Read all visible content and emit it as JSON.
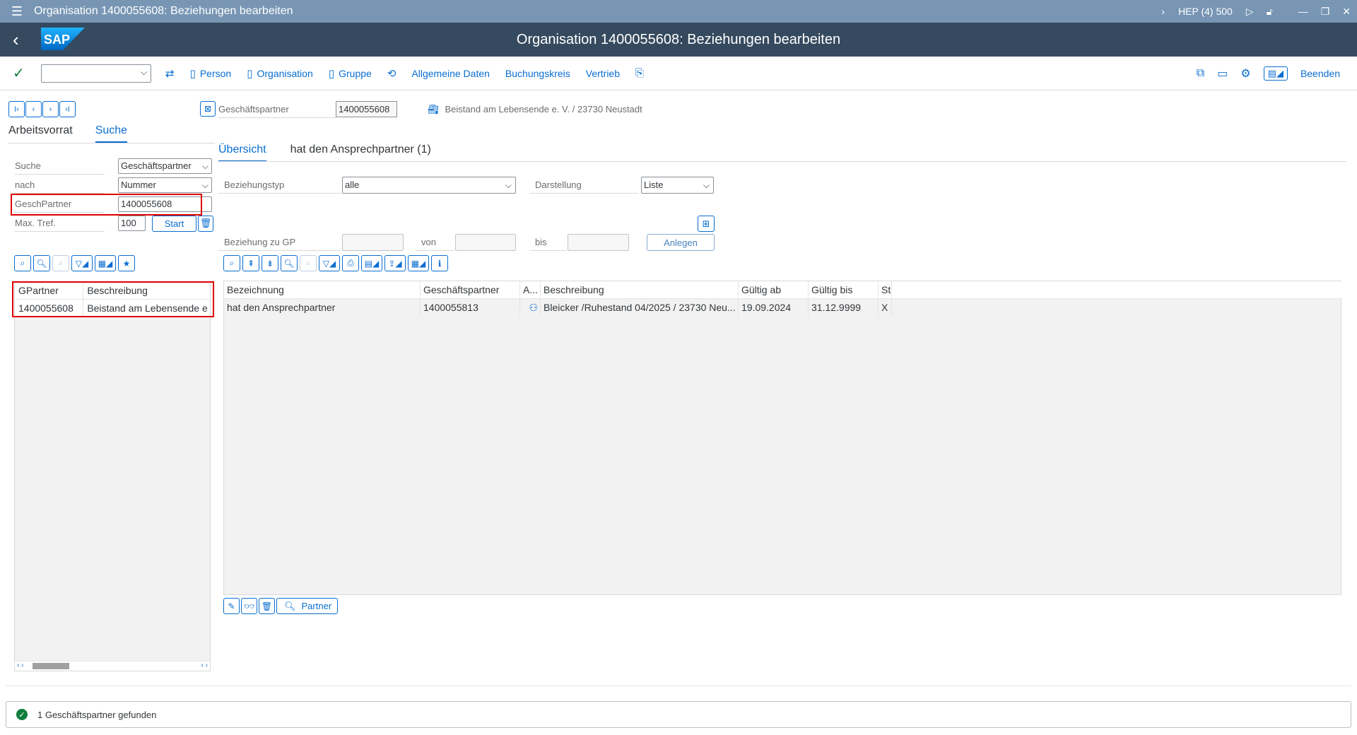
{
  "window": {
    "title": "Organisation 1400055608: Beziehungen bearbeiten",
    "system": "HEP (4) 500"
  },
  "header": {
    "title": "Organisation 1400055608: Beziehungen bearbeiten",
    "logo_text": "SAP"
  },
  "toolbar": {
    "command_value": "",
    "items": [
      "Person",
      "Organisation",
      "Gruppe",
      "Allgemeine Daten",
      "Buchungskreis",
      "Vertrieb"
    ],
    "exit_label": "Beenden"
  },
  "left": {
    "tabs": [
      "Arbeitsvorrat",
      "Suche"
    ],
    "active_tab": "Suche",
    "search_label": "Suche",
    "search_value": "Geschäftspartner",
    "by_label": "nach",
    "by_value": "Nummer",
    "bp_label": "GeschPartner",
    "bp_value": "1400055608",
    "max_label": "Max. Tref.",
    "max_value": "100",
    "start_label": "Start",
    "grid": {
      "columns": [
        "GPartner",
        "Beschreibung"
      ],
      "rows": [
        [
          "1400055608",
          "Beistand am Lebensende e"
        ]
      ]
    }
  },
  "partner_header": {
    "label": "Geschäftspartner",
    "value": "1400055608",
    "description": "Beistand am Lebensende e. V. / 23730 Neustadt"
  },
  "right": {
    "tabs": [
      "Übersicht",
      "hat den Ansprechpartner (1)"
    ],
    "active_tab": "Übersicht",
    "reltype_label": "Beziehungstyp",
    "reltype_value": "alle",
    "display_label": "Darstellung",
    "display_value": "Liste",
    "rel_to_label": "Beziehung zu GP",
    "from_label": "von",
    "to_label": "bis",
    "create_label": "Anlegen",
    "grid": {
      "columns": [
        "Bezeichnung",
        "Geschäftspartner",
        "A...",
        "Beschreibung",
        "Gültig ab",
        "Gültig bis",
        "St"
      ],
      "rows": [
        [
          "hat den Ansprechpartner",
          "1400055813",
          "",
          "Bleicker /Ruhestand 04/2025 / 23730 Neu...",
          "19.09.2024",
          "31.12.9999",
          "X"
        ]
      ]
    },
    "partner_button": "Partner"
  },
  "status": {
    "message": "1 Geschäftspartner gefunden"
  },
  "colors": {
    "title_bar": "#7896b4",
    "shell": "#354a5f",
    "accent": "#0a6ed1",
    "highlight": "#e00000",
    "success": "#107e3e"
  }
}
